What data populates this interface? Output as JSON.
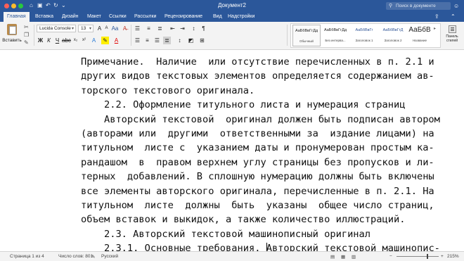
{
  "window": {
    "title": "Документ2",
    "search_placeholder": "Поиск в документе"
  },
  "tabs": [
    "Главная",
    "Вставка",
    "Дизайн",
    "Макет",
    "Ссылки",
    "Рассылки",
    "Рецензирование",
    "Вид",
    "Надстройки"
  ],
  "ribbon": {
    "paste_label": "Вставить",
    "font_name": "Lucida Console",
    "font_size": "13",
    "styles": [
      {
        "sample": "АаБбВвГгДд",
        "caption": "Обычный"
      },
      {
        "sample": "АаБбВвГгДд",
        "caption": "Без интерва..."
      },
      {
        "sample": "АаБбВвГг",
        "caption": "Заголовок 1"
      },
      {
        "sample": "АаБбВвГгД",
        "caption": "Заголовок 2"
      },
      {
        "sample": "АаБбВ",
        "caption": "Название"
      }
    ],
    "styles_pane_label": "Панель стилей"
  },
  "document": {
    "lines": [
      "Примечание.  Наличие  или отсутствие перечисленных в п. 2.1 и",
      "других видов текстовых элементов определяется содержанием ав-",
      "торского текстового оригинала.",
      "    2.2. Оформление титульного листа и нумерация страниц",
      "    Авторский текстовой  оригинал должен быть подписан автором",
      "(авторами или  другими  ответственными за  издание лицами) на",
      "титульном  листе с  указанием даты и пронумерован простым ка-",
      "рандашом  в  правом верхнем углу страницы без пропусков и ли-",
      "терных  добавлений. В сплошную нумерацию должны быть включены",
      "все элементы авторского оригинала, перечисленные в п. 2.1. На",
      "титульном  листе  должны  быть  указаны  общее число страниц,",
      "объем вставок и выкидок, а также количество иллюстраций.",
      "    2.3. Авторский текстовой машинописный оригинал",
      "    2.3.1. Основные требования. ",
      "Авторский текстовой машинопис-"
    ]
  },
  "status": {
    "page": "Страница 1 из 4",
    "words": "Число слов: 801",
    "language": "Русский",
    "zoom": "215%",
    "zoom_level_fraction": 0.72
  },
  "colors": {
    "accent": "#2b579a",
    "ribbon_bg": "#f3f3f3"
  }
}
